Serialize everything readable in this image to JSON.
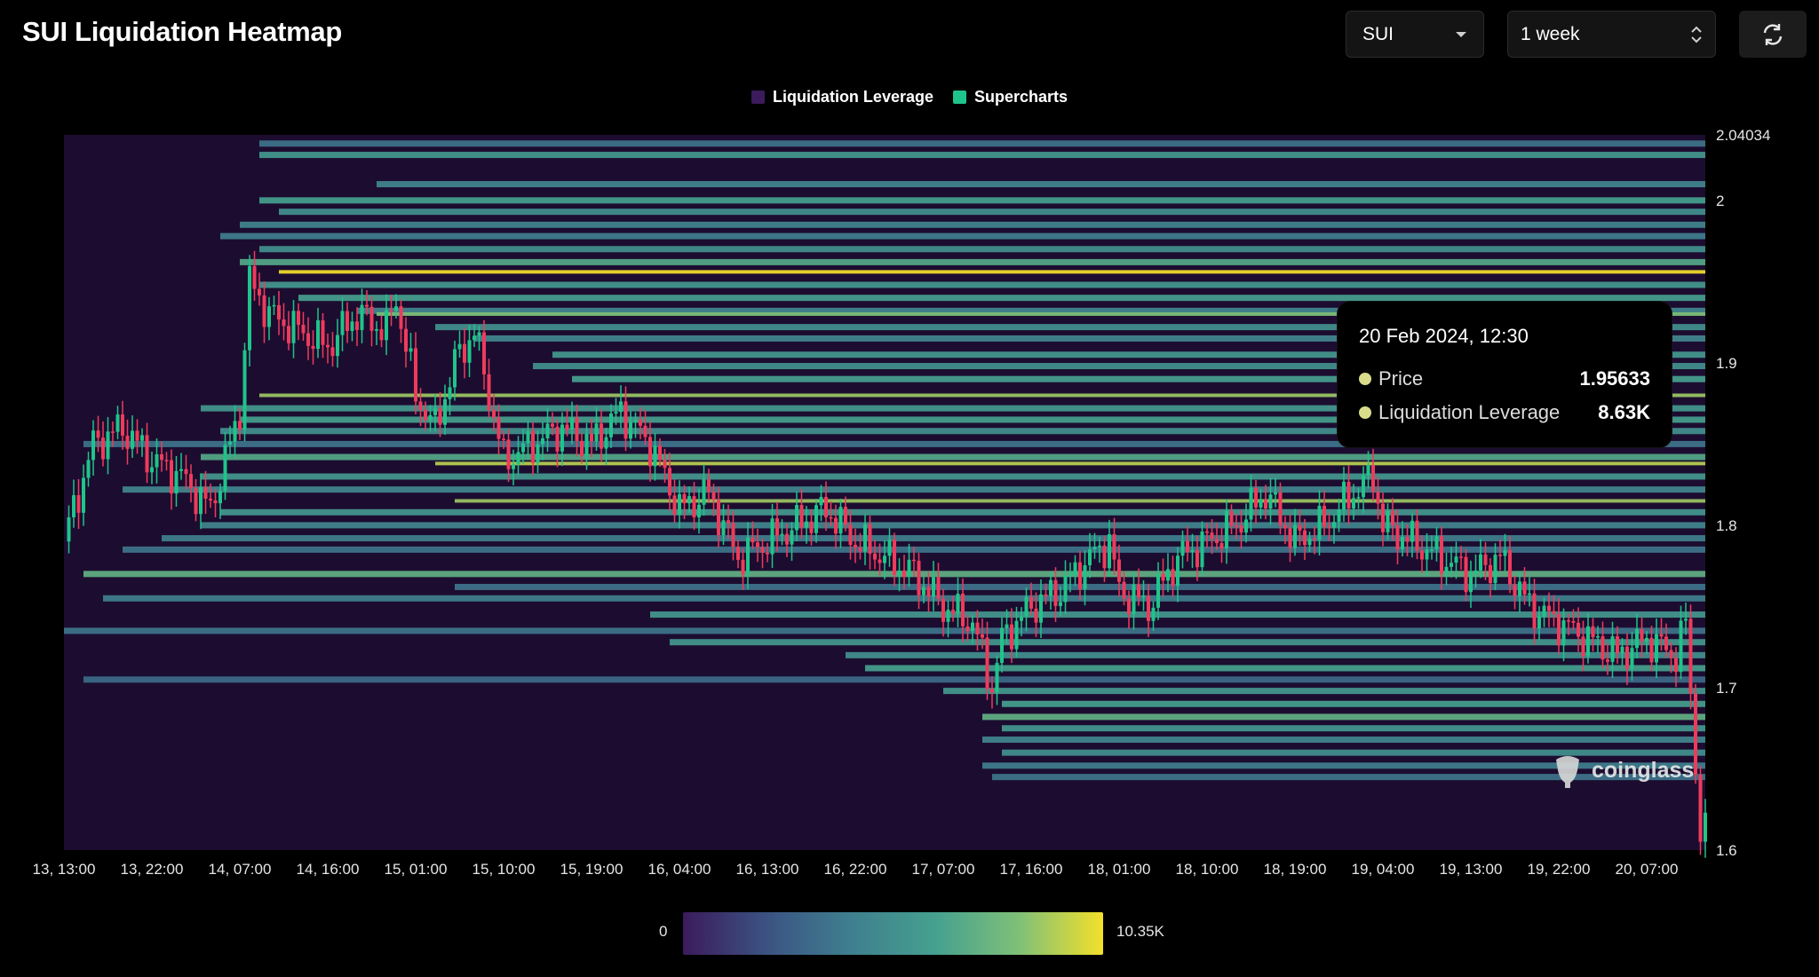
{
  "header": {
    "title": "SUI Liquidation Heatmap"
  },
  "controls": {
    "symbol": "SUI",
    "range": "1 week",
    "refresh_icon": "refresh-icon"
  },
  "legend": [
    {
      "label": "Liquidation Leverage",
      "color": "#3b1b5c"
    },
    {
      "label": "Supercharts",
      "color": "#1fc48a"
    }
  ],
  "tooltip": {
    "title": "20 Feb 2024, 12:30",
    "rows": [
      {
        "label": "Price",
        "value": "1.95633"
      },
      {
        "label": "Liquidation Leverage",
        "value": "8.63K"
      }
    ]
  },
  "colorbar": {
    "min_label": "0",
    "max_label": "10.35K",
    "colors": [
      "#3b1b5c",
      "#3b5382",
      "#3f7f8f",
      "#45a08f",
      "#7fc078",
      "#f3e02a"
    ]
  },
  "watermark": "coinglass",
  "chart_data": {
    "type": "heatmap",
    "title": "SUI Liquidation Heatmap",
    "ylim": [
      1.6,
      2.04034
    ],
    "y_ticks": [
      "1.6",
      "1.7",
      "1.8",
      "1.9",
      "2",
      "2.04034"
    ],
    "y_tick_values": [
      1.6,
      1.7,
      1.8,
      1.9,
      2.0,
      2.04034
    ],
    "x_tick_labels": [
      "13, 13:00",
      "13, 22:00",
      "14, 07:00",
      "14, 16:00",
      "15, 01:00",
      "15, 10:00",
      "15, 19:00",
      "16, 04:00",
      "16, 13:00",
      "16, 22:00",
      "17, 07:00",
      "17, 16:00",
      "18, 01:00",
      "18, 10:00",
      "18, 19:00",
      "19, 04:00",
      "19, 13:00",
      "19, 22:00",
      "20, 07:00"
    ],
    "x_tick_hours": [
      0,
      9,
      18,
      27,
      36,
      45,
      54,
      63,
      72,
      81,
      90,
      99,
      108,
      117,
      126,
      135,
      144,
      153,
      162
    ],
    "x_range_hours": [
      0,
      168
    ],
    "price_series": {
      "name": "Supercharts",
      "hours": [
        0,
        3,
        6,
        9,
        12,
        15,
        18,
        19,
        21,
        24,
        27,
        30,
        33,
        34,
        36,
        38,
        40,
        42,
        45,
        48,
        51,
        54,
        57,
        60,
        63,
        66,
        69,
        72,
        75,
        78,
        81,
        84,
        87,
        90,
        93,
        95,
        96,
        99,
        102,
        105,
        107,
        108,
        111,
        114,
        117,
        120,
        123,
        126,
        129,
        132,
        134,
        135,
        138,
        141,
        144,
        147,
        150,
        153,
        156,
        159,
        162,
        165,
        166,
        167.5
      ],
      "values": [
        1.79,
        1.85,
        1.86,
        1.84,
        1.83,
        1.81,
        1.87,
        1.95,
        1.93,
        1.92,
        1.91,
        1.93,
        1.92,
        1.94,
        1.88,
        1.86,
        1.9,
        1.92,
        1.84,
        1.85,
        1.86,
        1.85,
        1.87,
        1.85,
        1.81,
        1.82,
        1.78,
        1.79,
        1.8,
        1.81,
        1.79,
        1.78,
        1.77,
        1.75,
        1.74,
        1.7,
        1.73,
        1.75,
        1.76,
        1.78,
        1.79,
        1.76,
        1.75,
        1.78,
        1.79,
        1.8,
        1.82,
        1.79,
        1.8,
        1.82,
        1.83,
        1.8,
        1.79,
        1.78,
        1.77,
        1.78,
        1.75,
        1.74,
        1.73,
        1.72,
        1.73,
        1.72,
        1.74,
        1.61
      ]
    },
    "heat_levels": [
      {
        "price": 2.035,
        "start": 20,
        "intensity": 0.35
      },
      {
        "price": 2.028,
        "start": 20,
        "intensity": 0.55
      },
      {
        "price": 2.01,
        "start": 32,
        "intensity": 0.45
      },
      {
        "price": 2.0,
        "start": 20,
        "intensity": 0.6
      },
      {
        "price": 1.993,
        "start": 22,
        "intensity": 0.5
      },
      {
        "price": 1.985,
        "start": 18,
        "intensity": 0.45
      },
      {
        "price": 1.978,
        "start": 16,
        "intensity": 0.4
      },
      {
        "price": 1.97,
        "start": 20,
        "intensity": 0.5
      },
      {
        "price": 1.962,
        "start": 18,
        "intensity": 0.65
      },
      {
        "price": 1.956,
        "start": 22,
        "intensity": 1.0
      },
      {
        "price": 1.948,
        "start": 20,
        "intensity": 0.55
      },
      {
        "price": 1.94,
        "start": 24,
        "intensity": 0.6
      },
      {
        "price": 1.932,
        "start": 30,
        "intensity": 0.45
      },
      {
        "price": 1.93,
        "start": 32,
        "intensity": 0.8
      },
      {
        "price": 1.922,
        "start": 38,
        "intensity": 0.5
      },
      {
        "price": 1.915,
        "start": 42,
        "intensity": 0.45
      },
      {
        "price": 1.905,
        "start": 50,
        "intensity": 0.55
      },
      {
        "price": 1.898,
        "start": 48,
        "intensity": 0.5
      },
      {
        "price": 1.89,
        "start": 52,
        "intensity": 0.6
      },
      {
        "price": 1.88,
        "start": 20,
        "intensity": 0.85
      },
      {
        "price": 1.872,
        "start": 14,
        "intensity": 0.55
      },
      {
        "price": 1.865,
        "start": 18,
        "intensity": 0.6
      },
      {
        "price": 1.858,
        "start": 16,
        "intensity": 0.5
      },
      {
        "price": 1.85,
        "start": 2,
        "intensity": 0.35
      },
      {
        "price": 1.842,
        "start": 14,
        "intensity": 0.65
      },
      {
        "price": 1.838,
        "start": 38,
        "intensity": 0.9
      },
      {
        "price": 1.83,
        "start": 14,
        "intensity": 0.55
      },
      {
        "price": 1.822,
        "start": 6,
        "intensity": 0.45
      },
      {
        "price": 1.815,
        "start": 40,
        "intensity": 0.85
      },
      {
        "price": 1.808,
        "start": 16,
        "intensity": 0.55
      },
      {
        "price": 1.8,
        "start": 14,
        "intensity": 0.45
      },
      {
        "price": 1.792,
        "start": 10,
        "intensity": 0.4
      },
      {
        "price": 1.785,
        "start": 6,
        "intensity": 0.35
      },
      {
        "price": 1.77,
        "start": 2,
        "intensity": 0.7
      },
      {
        "price": 1.762,
        "start": 40,
        "intensity": 0.35
      },
      {
        "price": 1.755,
        "start": 4,
        "intensity": 0.4
      },
      {
        "price": 1.745,
        "start": 60,
        "intensity": 0.55
      },
      {
        "price": 1.735,
        "start": 0,
        "intensity": 0.35
      },
      {
        "price": 1.728,
        "start": 62,
        "intensity": 0.55
      },
      {
        "price": 1.72,
        "start": 80,
        "intensity": 0.5
      },
      {
        "price": 1.712,
        "start": 82,
        "intensity": 0.6
      },
      {
        "price": 1.705,
        "start": 2,
        "intensity": 0.3
      },
      {
        "price": 1.698,
        "start": 90,
        "intensity": 0.55
      },
      {
        "price": 1.69,
        "start": 96,
        "intensity": 0.6
      },
      {
        "price": 1.682,
        "start": 94,
        "intensity": 0.7
      },
      {
        "price": 1.675,
        "start": 96,
        "intensity": 0.55
      },
      {
        "price": 1.668,
        "start": 94,
        "intensity": 0.45
      },
      {
        "price": 1.66,
        "start": 96,
        "intensity": 0.5
      },
      {
        "price": 1.652,
        "start": 94,
        "intensity": 0.4
      },
      {
        "price": 1.645,
        "start": 95,
        "intensity": 0.35
      }
    ]
  }
}
